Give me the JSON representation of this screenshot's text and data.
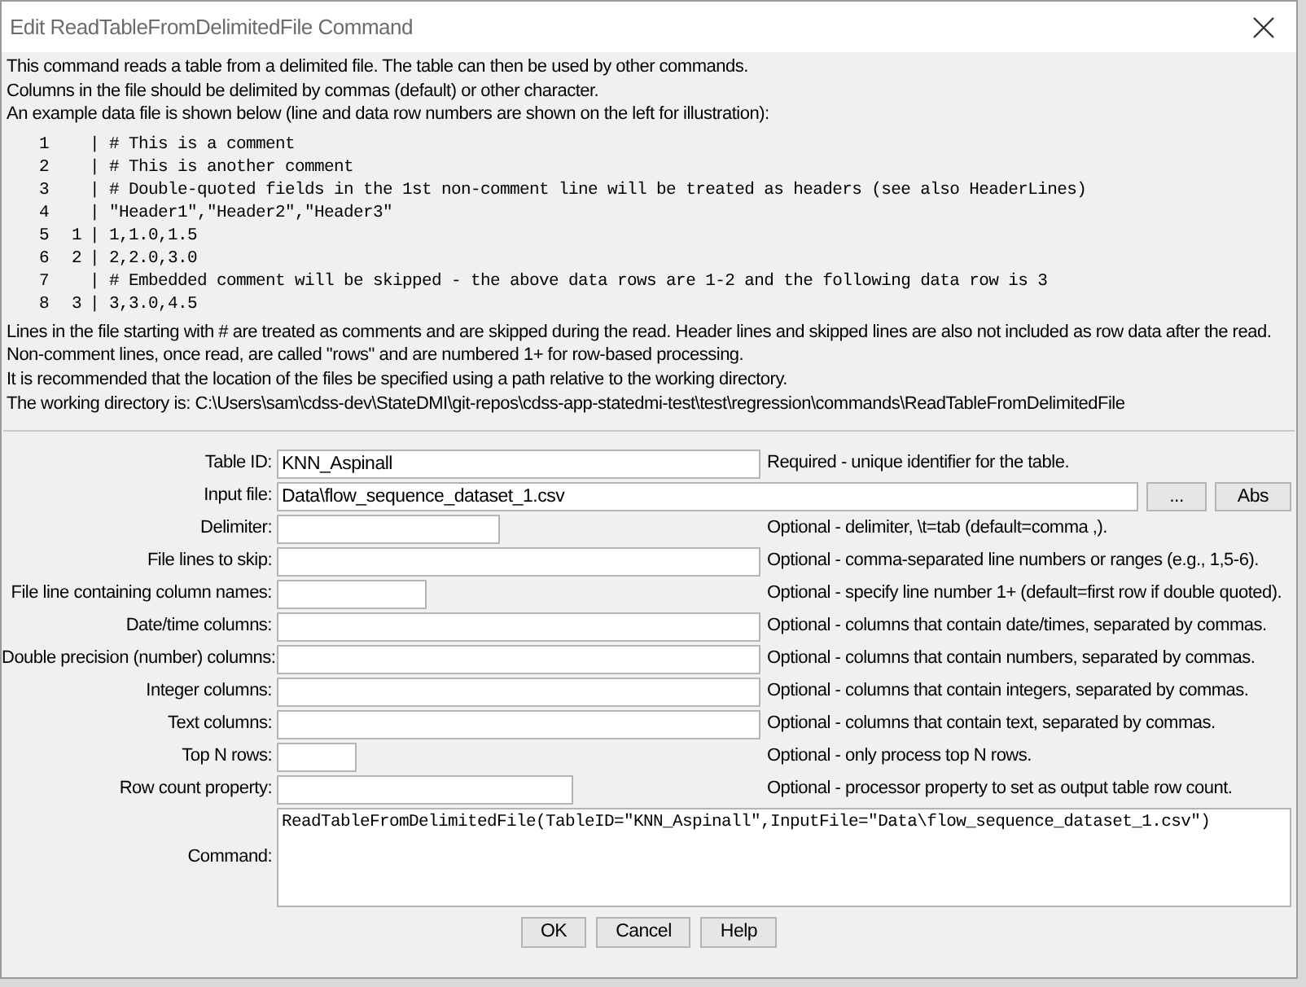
{
  "window": {
    "title": "Edit ReadTableFromDelimitedFile Command"
  },
  "intro": [
    "This command reads a table from a delimited file.  The table can then be used by other commands.",
    "Columns in the file should be delimited by commas (default) or other character.",
    "An example data file is shown below (line and data row numbers are shown on the left for illustration):"
  ],
  "example": [
    {
      "line": "1",
      "text": "| # This is a comment"
    },
    {
      "line": "2",
      "text": "| # This is another comment"
    },
    {
      "line": "3",
      "text": "| # Double-quoted fields in the 1st non-comment line will be treated as headers (see also HeaderLines)"
    },
    {
      "line": "4",
      "text": "| \"Header1\",\"Header2\",\"Header3\""
    },
    {
      "line": "5",
      "row": "1",
      "text": "| 1,1.0,1.5"
    },
    {
      "line": "6",
      "row": "2",
      "text": "| 2,2.0,3.0"
    },
    {
      "line": "7",
      "text": "| # Embedded comment will be skipped - the above data rows are 1-2 and the following data row is 3"
    },
    {
      "line": "8",
      "row": "3",
      "text": "| 3,3.0,4.5"
    }
  ],
  "notes": [
    "Lines in the file starting with # are treated as comments and are skipped during the read.  Header lines and skipped lines are also not included as row data after the read.",
    "Non-comment lines, once read, are called \"rows\" and are numbered 1+ for row-based processing.",
    "It is recommended that the location of the files be specified using a path relative to the working directory.",
    "The working directory is: C:\\Users\\sam\\cdss-dev\\StateDMI\\git-repos\\cdss-app-statedmi-test\\test\\regression\\commands\\ReadTableFromDelimitedFile"
  ],
  "fields": [
    {
      "label": "Table ID:",
      "value": "KNN_Aspinall",
      "note": "Required - unique identifier for the table."
    },
    {
      "label": "Input file:",
      "value": "Data\\flow_sequence_dataset_1.csv",
      "buttons": [
        "...",
        "Abs"
      ]
    },
    {
      "label": "Delimiter:",
      "note": "Optional - delimiter, \\t=tab (default=comma ,)."
    },
    {
      "label": "File lines to skip:",
      "note": "Optional - comma-separated line numbers or ranges (e.g., 1,5-6)."
    },
    {
      "label": "File line containing column names:",
      "note": "Optional - specify line number 1+ (default=first row if double quoted)."
    },
    {
      "label": "Date/time columns:",
      "note": "Optional - columns that contain date/times, separated by commas."
    },
    {
      "label": "Double precision (number) columns:",
      "note": "Optional - columns that contain numbers, separated by commas."
    },
    {
      "label": "Integer columns:",
      "note": "Optional - columns that contain integers, separated by commas."
    },
    {
      "label": "Text columns:",
      "note": "Optional - columns that contain text, separated by commas."
    },
    {
      "label": "Top N rows:",
      "note": "Optional - only process top N rows."
    },
    {
      "label": "Row count property:",
      "note": "Optional - processor property to set as output table row count."
    }
  ],
  "command": {
    "label": "Command:",
    "value": "ReadTableFromDelimitedFile(TableID=\"KNN_Aspinall\",InputFile=\"Data\\flow_sequence_dataset_1.csv\")"
  },
  "buttons": [
    "OK",
    "Cancel",
    "Help"
  ]
}
